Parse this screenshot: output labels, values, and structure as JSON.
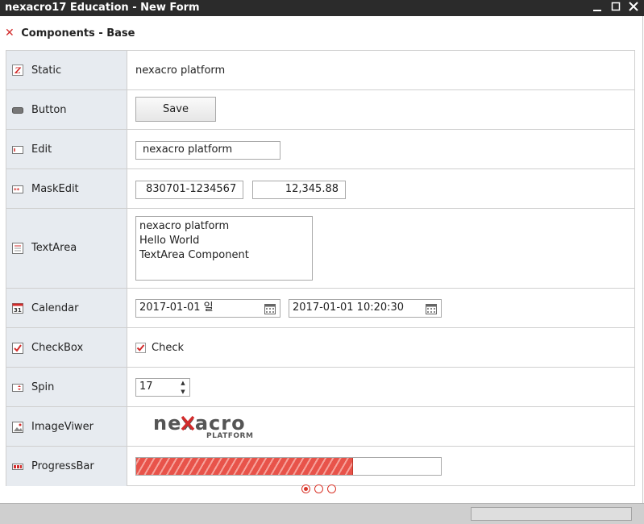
{
  "window": {
    "title": "nexacro17 Education - New Form"
  },
  "section": {
    "title": "Components - Base"
  },
  "rows": {
    "static": {
      "label": "Static",
      "value": "nexacro platform"
    },
    "button": {
      "label": "Button",
      "button_text": "Save"
    },
    "edit": {
      "label": "Edit",
      "value": "nexacro platform"
    },
    "maskedit": {
      "label": "MaskEdit",
      "value1": "830701-1234567",
      "value2": "12,345.88"
    },
    "textarea": {
      "label": "TextArea",
      "lines": [
        "nexacro platform",
        "Hello World",
        "TextArea Component"
      ]
    },
    "calendar": {
      "label": "Calendar",
      "value1": "2017-01-01 일",
      "value2": "2017-01-01 10:20:30"
    },
    "checkbox": {
      "label": "CheckBox",
      "text": "Check",
      "checked": true
    },
    "spin": {
      "label": "Spin",
      "value": "17"
    },
    "imageviewer": {
      "label": "ImageViwer",
      "logo_text": "nexacro",
      "logo_sub": "PLATFORM"
    },
    "progressbar": {
      "label": "ProgressBar",
      "percent": 71
    }
  },
  "pager": {
    "count": 3,
    "active": 0
  },
  "colors": {
    "accent": "#d9362b",
    "label_bg": "#e7ebf0",
    "titlebar": "#2b2b2b"
  },
  "icons": {
    "static": "static-icon",
    "button": "button-icon",
    "edit": "edit-icon",
    "maskedit": "maskedit-icon",
    "textarea": "textarea-icon",
    "calendar": "calendar-icon",
    "checkbox": "checkbox-icon",
    "spin": "spin-icon",
    "imageviewer": "image-icon",
    "progressbar": "progressbar-icon"
  }
}
